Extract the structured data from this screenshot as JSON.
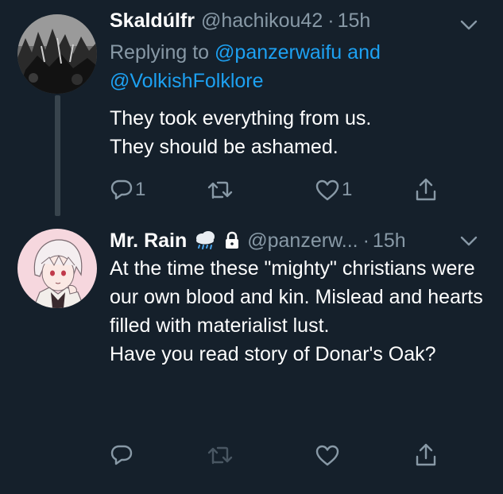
{
  "tweets": [
    {
      "name": "Skaldúlfr",
      "handle": "@hachikou42",
      "separator": "·",
      "time": "15h",
      "replying_prefix": "Replying to",
      "mention_1": "@panzerwaifu",
      "replying_join": "and",
      "mention_2": "@VolkishFolklore",
      "text": "They took everything from us.\nThey should be ashamed.",
      "reply_count": "1",
      "like_count": "1"
    },
    {
      "name": "Mr. Rain",
      "handle": "@panzerw...",
      "separator": "·",
      "time": "15h",
      "text": "At the time these \"mighty\" christians were our own blood and kin. Mislead and hearts filled with materialist lust.\nHave you read story of Donar's Oak?"
    }
  ],
  "icons": {
    "reply": "reply-icon",
    "retweet": "retweet-icon",
    "like": "heart-icon",
    "share": "share-icon",
    "chevron": "chevron-down-icon",
    "weather": "rain-cloud-icon",
    "lock": "lock-icon"
  },
  "colors": {
    "background": "#15202b",
    "secondary_text": "#8899a6",
    "link": "#1da1f2",
    "thread_line": "#38444d"
  }
}
